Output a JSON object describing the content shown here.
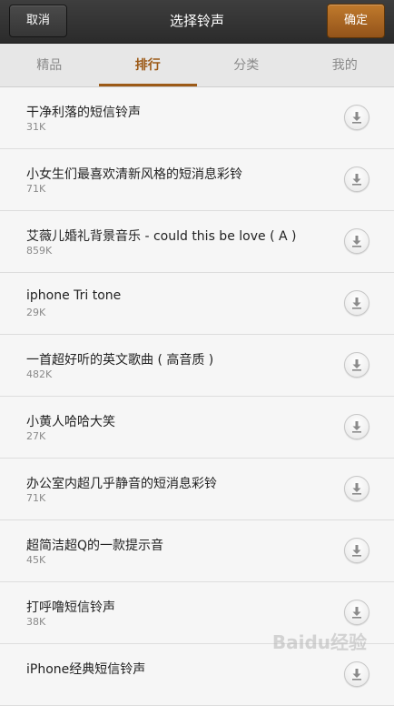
{
  "header": {
    "title": "选择铃声",
    "cancel_label": "取消",
    "ok_label": "确定"
  },
  "tabs": [
    {
      "label": "精品",
      "active": false
    },
    {
      "label": "排行",
      "active": true
    },
    {
      "label": "分类",
      "active": false
    },
    {
      "label": "我的",
      "active": false
    }
  ],
  "ringtones": [
    {
      "name": "干净利落的短信铃声",
      "size": "31K"
    },
    {
      "name": "小女生们最喜欢清新风格的短消息彩铃",
      "size": "71K"
    },
    {
      "name": "艾薇儿婚礼背景音乐 - could this be love ( A )",
      "size": "859K"
    },
    {
      "name": "iphone Tri tone",
      "size": "29K"
    },
    {
      "name": "一首超好听的英文歌曲 ( 高音质 )",
      "size": "482K"
    },
    {
      "name": "小黄人哈哈大笑",
      "size": "27K"
    },
    {
      "name": "办公室内超几乎静音的短消息彩铃",
      "size": "71K"
    },
    {
      "name": "超简洁超Q的一款提示音",
      "size": "45K"
    },
    {
      "name": "打呼噜短信铃声",
      "size": "38K"
    },
    {
      "name": "iPhone经典短信铃声",
      "size": ""
    }
  ],
  "icons": {
    "download": "download-icon"
  },
  "watermark": "Baidu经验",
  "colors": {
    "accent": "#9c5a17",
    "ok_button": "#b06e26",
    "topbar": "#333333"
  }
}
